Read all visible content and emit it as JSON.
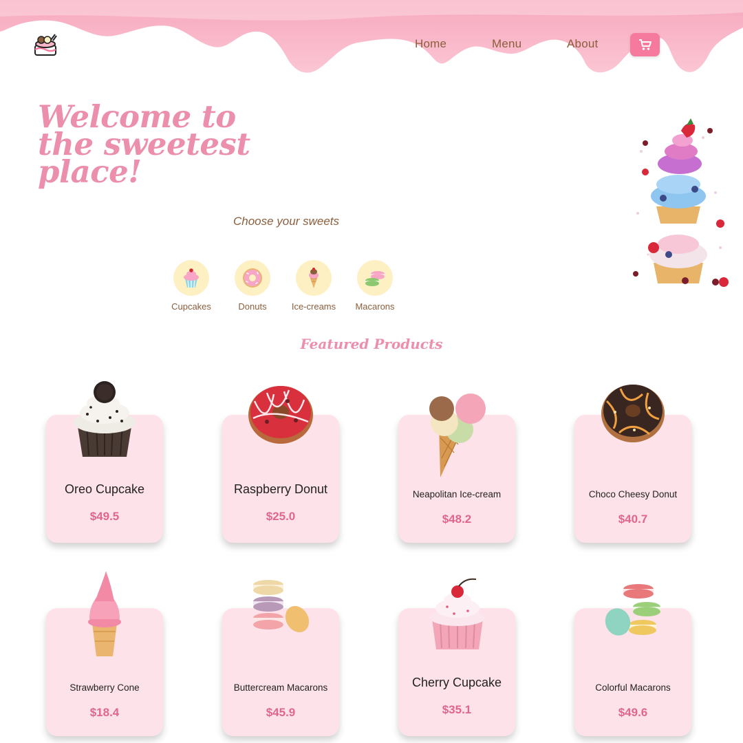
{
  "nav": {
    "links": [
      "Home",
      "Menu",
      "About"
    ]
  },
  "hero": {
    "title_line1": "Welcome to",
    "title_line2": "the sweetest place!"
  },
  "categories": {
    "heading": "Choose your sweets",
    "items": [
      "Cupcakes",
      "Donuts",
      "Ice-creams",
      "Macarons"
    ]
  },
  "featured": {
    "heading": "Featured Products",
    "products": [
      {
        "name": "Oreo Cupcake",
        "price": "$49.5"
      },
      {
        "name": "Raspberry Donut",
        "price": "$25.0"
      },
      {
        "name": "Neapolitan Ice-cream",
        "price": "$48.2"
      },
      {
        "name": "Choco Cheesy Donut",
        "price": "$40.7"
      },
      {
        "name": "Strawberry Cone",
        "price": "$18.4"
      },
      {
        "name": "Buttercream Macarons",
        "price": "$45.9"
      },
      {
        "name": "Cherry Cupcake",
        "price": "$35.1"
      },
      {
        "name": "Colorful Macarons",
        "price": "$49.6"
      }
    ]
  },
  "colors": {
    "accent_pink": "#eb8fac",
    "cart_button": "#f57a9e",
    "card_background": "#fde2ea",
    "price": "#e0668c",
    "brown_text": "#8b5e3c",
    "category_circle": "#fdf1c4"
  },
  "icons": [
    "ice-cream-cake-logo-icon",
    "cart-icon",
    "cupcake-icon",
    "donut-icon",
    "ice-cream-cone-icon",
    "macarons-icon"
  ]
}
